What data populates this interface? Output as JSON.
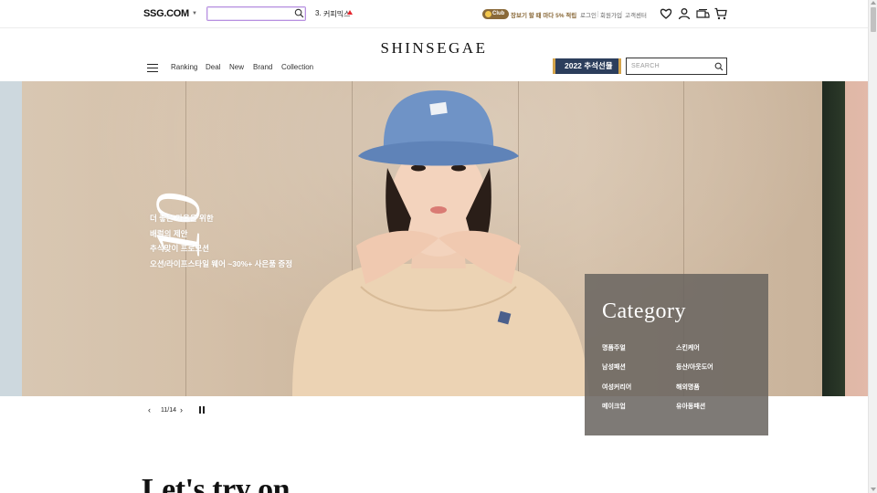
{
  "topbar": {
    "logo": "SSG.COM",
    "search_placeholder": "",
    "ranking": {
      "number": "3.",
      "keyword": "커피믹스"
    },
    "club": {
      "badge": "Club",
      "text": "장보기 할 때 마다 5% 적립"
    },
    "links": [
      "로그인",
      "회원가입",
      "고객센터"
    ],
    "icons": [
      "heart-icon",
      "user-icon",
      "delivery-truck-icon",
      "cart-icon"
    ]
  },
  "header": {
    "brand": "SHINSEGAE",
    "nav": [
      "Ranking",
      "Deal",
      "New",
      "Brand",
      "Collection"
    ],
    "promo_button": "2022 추석선물",
    "search_placeholder": "SEARCH"
  },
  "hero": {
    "number": "10",
    "lines": [
      "더 좋은 가을을 위한",
      "배럴의 제안",
      "추석맞이 프로모션",
      "오션/라이프스타일 웨어 ~30%+ 사은품 증정"
    ]
  },
  "pagination": {
    "current": "11",
    "total": "14",
    "label": "11/14"
  },
  "category": {
    "title": "Category",
    "items": [
      "명품주얼",
      "스킨케어",
      "남성패션",
      "등산/아웃도어",
      "여성커리어",
      "해외명품",
      "메이크업",
      "유아동패션"
    ]
  },
  "section": {
    "title": "Let's try on"
  },
  "colors": {
    "promo_bg": "#2c3e5c",
    "promo_accent": "#d4a44b",
    "club": "#8a6a3a",
    "rank_up": "#e5262e",
    "category_panel": "#69645f"
  }
}
